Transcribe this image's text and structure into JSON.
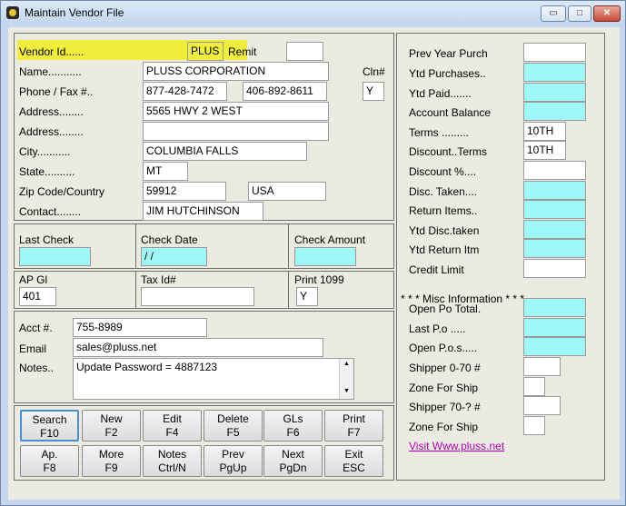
{
  "window": {
    "title": "Maintain Vendor File",
    "min_glyph": "▭",
    "max_glyph": "□",
    "close_glyph": "✕"
  },
  "vendor": {
    "id_label": "Vendor Id......",
    "id_value": "PLUS",
    "remit_label": "Remit",
    "remit_value": "",
    "name_label": "Name...........",
    "name_value": "PLUSS CORPORATION",
    "cln_label": "Cln#",
    "cln_value": "Y",
    "phone_label": "Phone / Fax #..",
    "phone_value": "877-428-7472",
    "fax_value": "406-892-8611",
    "address_label": "Address........",
    "address1_value": "5565 HWY 2 WEST",
    "address2_value": "",
    "city_label": "City...........",
    "city_value": "COLUMBIA FALLS",
    "state_label": "State..........",
    "state_value": "MT",
    "zip_label": "Zip Code/Country",
    "zip_value": "59912",
    "country_value": "USA",
    "contact_label": "Contact........",
    "contact_value": "JIM HUTCHINSON"
  },
  "check": {
    "last_check_label": "Last Check",
    "last_check_value": "",
    "check_date_label": "Check Date",
    "check_date_value": " /  /",
    "check_amount_label": "Check Amount",
    "check_amount_value": ""
  },
  "ap": {
    "ap_gl_label": "AP Gl",
    "ap_gl_value": "401",
    "tax_id_label": "Tax Id#",
    "tax_id_value": "",
    "print_1099_label": "Print 1099",
    "print_1099_value": "Y"
  },
  "account": {
    "acct_label": "Acct #.",
    "acct_value": "755-8989",
    "email_label": "Email",
    "email_value": "sales@pluss.net",
    "notes_label": "Notes..",
    "notes_value": "Update Password = 4887123"
  },
  "buttons": {
    "search": [
      "Search",
      "F10"
    ],
    "new": [
      "New",
      "F2"
    ],
    "edit": [
      "Edit",
      "F4"
    ],
    "delete": [
      "Delete",
      "F5"
    ],
    "gls": [
      "GLs",
      "F6"
    ],
    "print": [
      "Print",
      "F7"
    ],
    "ap": [
      "Ap.",
      "F8"
    ],
    "more": [
      "More",
      "F9"
    ],
    "notes": [
      "Notes",
      "Ctrl/N"
    ],
    "prev": [
      "Prev",
      "PgUp"
    ],
    "next": [
      "Next",
      "PgDn"
    ],
    "exit": [
      "Exit",
      "ESC"
    ]
  },
  "right": {
    "prev_year_purch_label": "Prev Year Purch",
    "prev_year_purch_value": "",
    "ytd_purchases_label": "Ytd Purchases..",
    "ytd_purchases_value": "",
    "ytd_paid_label": "Ytd Paid.......",
    "ytd_paid_value": "",
    "account_balance_label": "Account Balance",
    "account_balance_value": "",
    "terms_label": "Terms .........",
    "terms_value": "10TH",
    "discount_terms_label": "Discount..Terms",
    "discount_terms_value": "10TH",
    "discount_pct_label": "Discount %....",
    "discount_pct_value": "",
    "disc_taken_label": "Disc. Taken....",
    "disc_taken_value": "",
    "return_items_label": "Return Items..",
    "return_items_value": "",
    "ytd_disc_taken_label": "Ytd Disc.taken",
    "ytd_disc_taken_value": "",
    "ytd_return_itm_label": "Ytd Return Itm",
    "ytd_return_itm_value": "",
    "credit_limit_label": "Credit Limit",
    "credit_limit_value": "",
    "misc_header": "* * * Misc Information * * *",
    "open_po_total_label": "Open Po Total.",
    "open_po_total_value": "",
    "last_po_label": "Last P.o .....",
    "last_po_value": "",
    "open_pos_label": "Open P.o.s.....",
    "open_pos_value": "",
    "shipper_070_label": "Shipper 0-70 #",
    "shipper_070_value": "",
    "zone_for_ship1_label": "Zone For Ship",
    "zone_for_ship1_value": "",
    "shipper_70_label": "Shipper 70-? #",
    "shipper_70_value": "",
    "zone_for_ship2_label": "Zone For Ship",
    "zone_for_ship2_value": "",
    "visit_link": "Visit Www.pluss.net"
  }
}
